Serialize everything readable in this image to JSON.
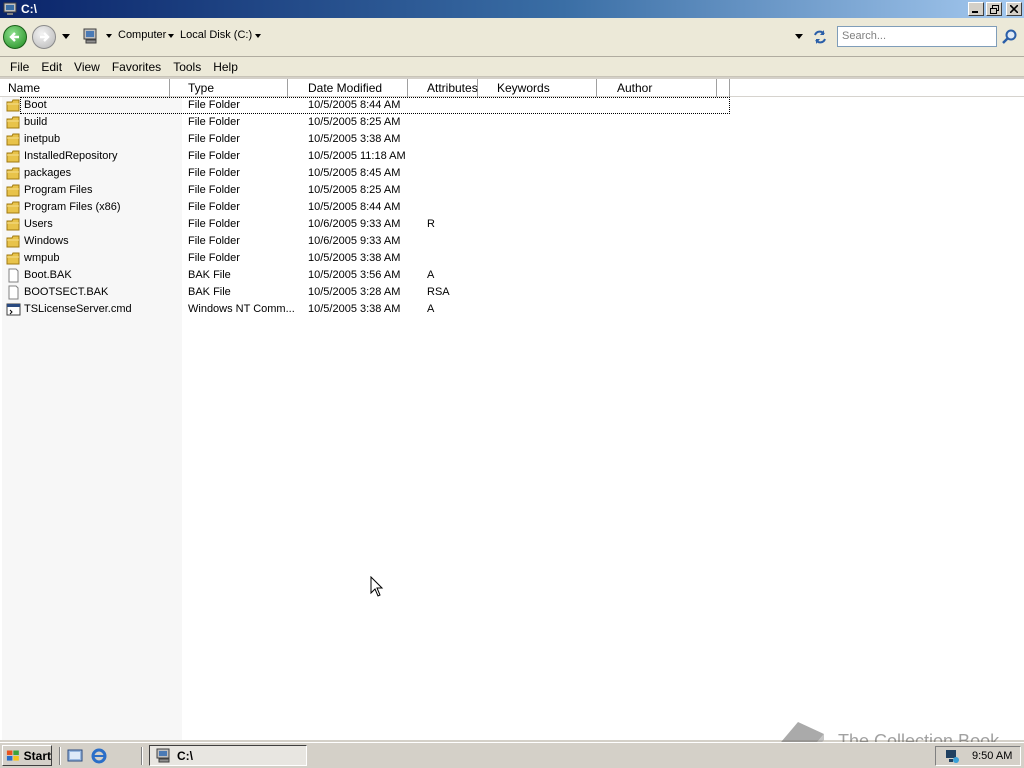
{
  "window": {
    "title": "C:\\"
  },
  "address_bar": {
    "breadcrumbs": [
      {
        "label": "Computer"
      },
      {
        "label": "Local Disk (C:)"
      }
    ],
    "search_placeholder": "Search..."
  },
  "menu": [
    {
      "label": "File"
    },
    {
      "label": "Edit"
    },
    {
      "label": "View"
    },
    {
      "label": "Favorites"
    },
    {
      "label": "Tools"
    },
    {
      "label": "Help"
    }
  ],
  "columns": [
    {
      "label": "Name"
    },
    {
      "label": "Type"
    },
    {
      "label": "Date Modified"
    },
    {
      "label": "Attributes"
    },
    {
      "label": "Keywords"
    },
    {
      "label": "Author"
    }
  ],
  "files": [
    {
      "name": "Boot",
      "type": "File Folder",
      "date": "10/5/2005 8:44 AM",
      "attributes": "",
      "icon": "folder-icon"
    },
    {
      "name": "build",
      "type": "File Folder",
      "date": "10/5/2005 8:25 AM",
      "attributes": "",
      "icon": "folder-icon"
    },
    {
      "name": "inetpub",
      "type": "File Folder",
      "date": "10/5/2005 3:38 AM",
      "attributes": "",
      "icon": "folder-icon"
    },
    {
      "name": "InstalledRepository",
      "type": "File Folder",
      "date": "10/5/2005 11:18 AM",
      "attributes": "",
      "icon": "folder-icon"
    },
    {
      "name": "packages",
      "type": "File Folder",
      "date": "10/5/2005 8:45 AM",
      "attributes": "",
      "icon": "folder-icon"
    },
    {
      "name": "Program Files",
      "type": "File Folder",
      "date": "10/5/2005 8:25 AM",
      "attributes": "",
      "icon": "folder-icon"
    },
    {
      "name": "Program Files (x86)",
      "type": "File Folder",
      "date": "10/5/2005 8:44 AM",
      "attributes": "",
      "icon": "folder-icon"
    },
    {
      "name": "Users",
      "type": "File Folder",
      "date": "10/6/2005 9:33 AM",
      "attributes": "R",
      "icon": "folder-icon"
    },
    {
      "name": "Windows",
      "type": "File Folder",
      "date": "10/6/2005 9:33 AM",
      "attributes": "",
      "icon": "folder-icon"
    },
    {
      "name": "wmpub",
      "type": "File Folder",
      "date": "10/5/2005 3:38 AM",
      "attributes": "",
      "icon": "folder-icon"
    },
    {
      "name": "Boot.BAK",
      "type": "BAK File",
      "date": "10/5/2005 3:56 AM",
      "attributes": "A",
      "icon": "file-icon"
    },
    {
      "name": "BOOTSECT.BAK",
      "type": "BAK File",
      "date": "10/5/2005 3:28 AM",
      "attributes": "RSA",
      "icon": "file-icon"
    },
    {
      "name": "TSLicenseServer.cmd",
      "type": "Windows NT Comm...",
      "date": "10/5/2005 3:38 AM",
      "attributes": "A",
      "icon": "cmd-file-icon"
    }
  ],
  "taskbar": {
    "start_label": "Start",
    "task_label": "C:\\",
    "clock": "9:50 AM"
  },
  "watermark": {
    "text": "The Collection Book"
  }
}
